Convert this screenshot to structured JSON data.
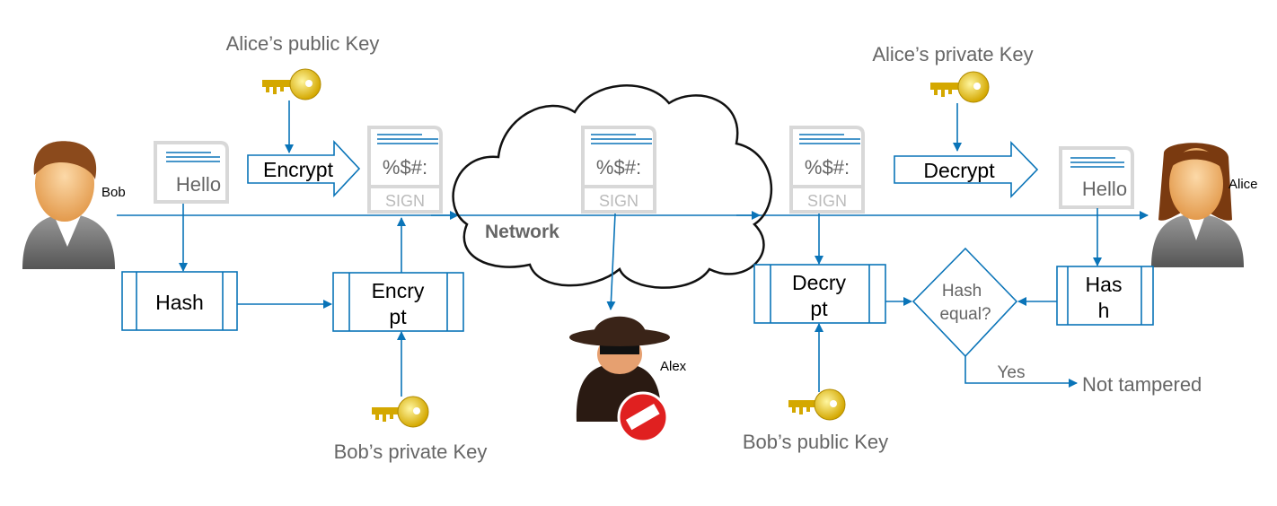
{
  "colors": {
    "flow": "#0a74b8",
    "label": "#666666",
    "doc_border": "#d8d8d8"
  },
  "actors": {
    "bob": "Bob",
    "alice": "Alice",
    "alex": "Alex"
  },
  "keys": {
    "alice_public": "Alice’s public Key",
    "alice_private": "Alice’s private Key",
    "bob_private": "Bob’s private Key",
    "bob_public": "Bob’s public Key"
  },
  "documents": {
    "plain": "Hello",
    "cipher": "%$#:",
    "sign": "SIGN"
  },
  "arrows": {
    "encrypt": "Encrypt",
    "decrypt": "Decrypt"
  },
  "process": {
    "hash_bob": "Hash",
    "encrypt_line1": "Encry",
    "encrypt_line2": "pt",
    "decrypt_line1": "Decry",
    "decrypt_line2": "pt",
    "hash_alice_line1": "Has",
    "hash_alice_line2": "h"
  },
  "decision": {
    "line1": "Hash",
    "line2": "equal?",
    "yes": "Yes",
    "result": "Not tampered"
  },
  "network": "Network",
  "icons": [
    "person-icon",
    "key-icon",
    "document-icon",
    "cloud-icon",
    "spy-icon",
    "no-entry-icon"
  ]
}
